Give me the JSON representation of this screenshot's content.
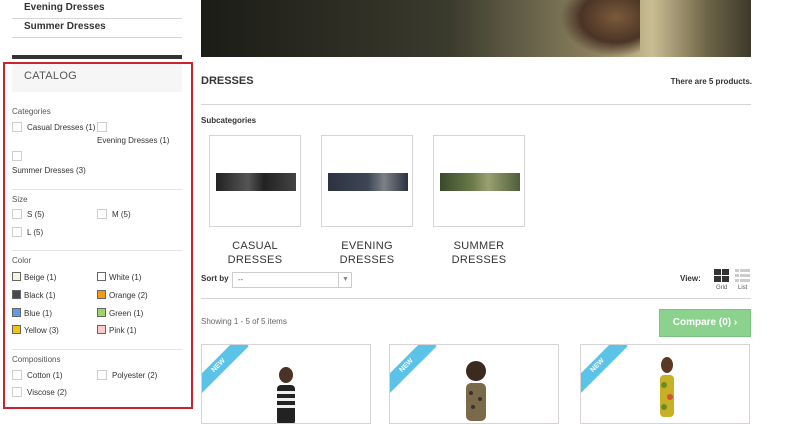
{
  "top_links": [
    "Evening Dresses",
    "Summer Dresses"
  ],
  "catalog": {
    "title": "CATALOG",
    "categories": {
      "title": "Categories",
      "items": [
        {
          "label": "Casual Dresses (1)"
        },
        {
          "label": "Evening Dresses (1)"
        },
        {
          "label": "Summer Dresses (3)"
        }
      ]
    },
    "size": {
      "title": "Size",
      "items": [
        {
          "label": "S (5)"
        },
        {
          "label": "M (5)"
        },
        {
          "label": "L (5)"
        }
      ]
    },
    "color": {
      "title": "Color",
      "items": [
        {
          "label": "Beige (1)",
          "swatch": "#f5f5dc"
        },
        {
          "label": "White (1)",
          "swatch": "#ffffff"
        },
        {
          "label": "Black (1)",
          "swatch": "#434a54"
        },
        {
          "label": "Orange (2)",
          "swatch": "#f39c11"
        },
        {
          "label": "Blue (1)",
          "swatch": "#5d9cec"
        },
        {
          "label": "Green (1)",
          "swatch": "#a0d468"
        },
        {
          "label": "Yellow (3)",
          "swatch": "#f1c40f"
        },
        {
          "label": "Pink (1)",
          "swatch": "#fcc8c8"
        }
      ]
    },
    "compositions": {
      "title": "Compositions",
      "items": [
        {
          "label": "Cotton (1)"
        },
        {
          "label": "Polyester (2)"
        },
        {
          "label": "Viscose (2)"
        }
      ]
    }
  },
  "main": {
    "title": "DRESSES",
    "count_text": "There are 5 products.",
    "subcategories_label": "Subcategories",
    "subcategories": [
      {
        "name_line1": "CASUAL",
        "name_line2": "DRESSES"
      },
      {
        "name_line1": "EVENING",
        "name_line2": "DRESSES"
      },
      {
        "name_line1": "SUMMER",
        "name_line2": "DRESSES"
      }
    ],
    "sort_label": "Sort by",
    "sort_value": "--",
    "view_label": "View:",
    "view_grid": "Grid",
    "view_list": "List",
    "showing": "Showing 1 - 5 of 5 items",
    "compare_label": "Compare (0)",
    "products": [
      {
        "badge": "NEW"
      },
      {
        "badge": "NEW"
      },
      {
        "badge": "NEW"
      }
    ]
  },
  "colors": {
    "highlight_border": "#c9252c",
    "compare_button": "#8cd28f",
    "new_badge": "#5bc3e8"
  }
}
